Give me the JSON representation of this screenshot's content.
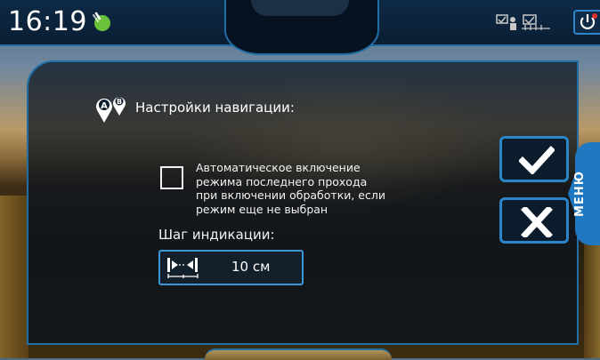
{
  "status_bar": {
    "time": "16:19",
    "icons": [
      "gps-signal-icon",
      "implement-status-icon",
      "section-control-icon",
      "power-button-icon"
    ]
  },
  "panel": {
    "title": "Настройки навигации:",
    "title_icon": "ab-line-icon"
  },
  "settings": {
    "auto_mode_checkbox": {
      "checked": false,
      "label_lines": [
        "Автоматическое включение",
        "режима последнего прохода",
        "при включении обработки, если",
        "режим еще не выбран"
      ]
    },
    "step": {
      "label": "Шаг индикации:",
      "value": "10 см",
      "icon": "spacing-width-icon"
    }
  },
  "actions": {
    "confirm_icon": "checkmark-icon",
    "cancel_icon": "close-icon"
  },
  "side_menu": {
    "label": "МЕНЮ"
  },
  "colors": {
    "accent_blue": "#2a86c6",
    "topbar_bg": "#0e2a46",
    "gps_green": "#6ac23b"
  }
}
